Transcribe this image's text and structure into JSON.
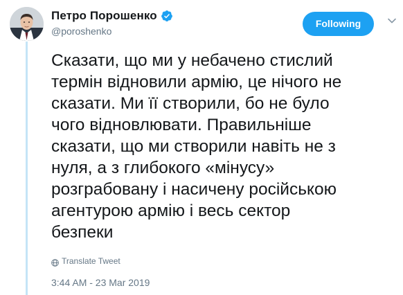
{
  "author": {
    "display_name": "Петро Порошенко",
    "handle": "@poroshenko",
    "avatar_icon": "user-avatar-photo",
    "verified_icon": "verified-badge-icon",
    "verified_color": "#1da1f2"
  },
  "follow_button": {
    "label": "Following",
    "color": "#1da1f2"
  },
  "menu_icon": "chevron-down-icon",
  "tweet": {
    "text": "Сказати, що ми у небачено стислий\nтермін відновили армію, це нічого не\nсказати. Ми її створили, бо не було\nчого відновлювати. Правильніше\nсказати, що ми створили навіть не з\nнуля, а з глибокого «мінусу»\nрозграбовану і насичену російською\nагентурою армію і весь сектор\nбезпеки"
  },
  "translate": {
    "icon": "globe-icon",
    "label": "Translate Tweet"
  },
  "timestamp": "3:44 AM - 23 Mar 2019",
  "colors": {
    "text_primary": "#14171a",
    "text_secondary": "#657786",
    "thread_line": "#c4e4f7"
  }
}
